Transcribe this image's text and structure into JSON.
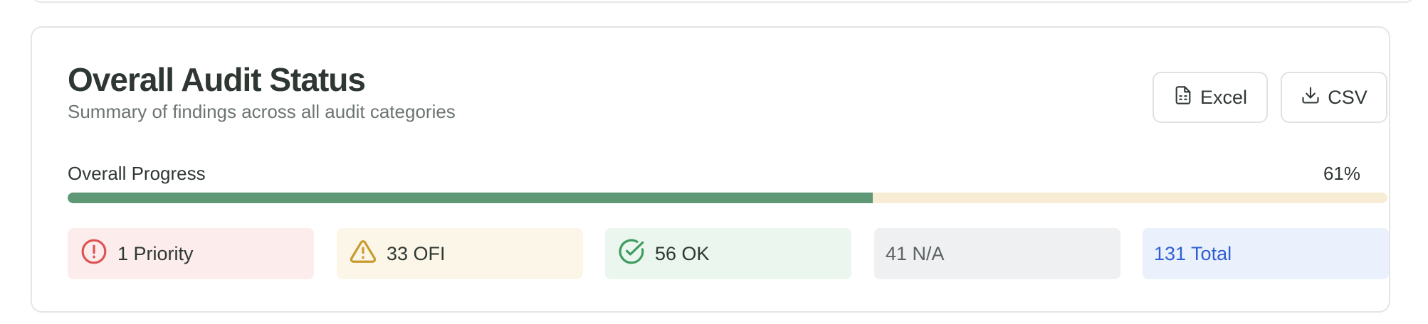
{
  "card": {
    "title": "Overall Audit Status",
    "subtitle": "Summary of findings across all audit categories"
  },
  "actions": {
    "excel_label": "Excel",
    "csv_label": "CSV"
  },
  "progress": {
    "label": "Overall Progress",
    "value_text": "61%",
    "value_fraction": 0.61
  },
  "stats": {
    "priority": {
      "label": "1 Priority",
      "icon": "alert-circle-icon",
      "color": "#e05252"
    },
    "ofi": {
      "label": "33 OFI",
      "icon": "warning-triangle-icon",
      "color": "#c99a2e"
    },
    "ok": {
      "label": "56 OK",
      "icon": "check-circle-icon",
      "color": "#3f9b5f"
    },
    "na": {
      "label": "41 N/A"
    },
    "total": {
      "label": "131 Total",
      "color": "#2f5ed4"
    }
  },
  "colors": {
    "progress_fill": "#5e9877",
    "progress_track": "#f7edd4"
  }
}
